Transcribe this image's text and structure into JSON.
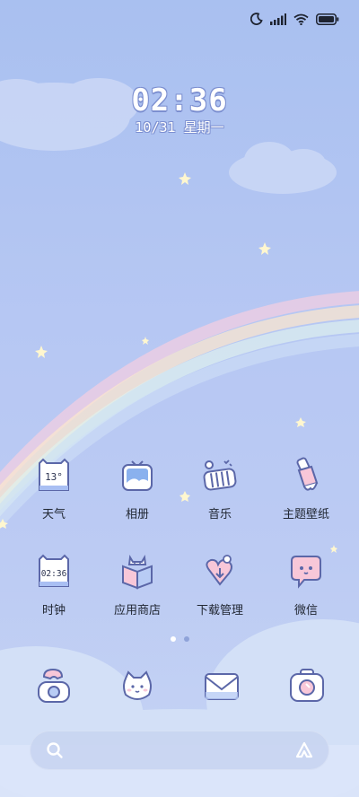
{
  "status_bar": {
    "icons": [
      "moon-icon",
      "signal-icon",
      "wifi-icon",
      "battery-icon"
    ]
  },
  "clock": {
    "time": "02:36",
    "date": "10/31 星期一"
  },
  "apps": [
    {
      "label": "天气",
      "icon": "weather-calendar-icon",
      "badge": "13°"
    },
    {
      "label": "相册",
      "icon": "photo-frame-icon"
    },
    {
      "label": "音乐",
      "icon": "piano-icon"
    },
    {
      "label": "主题壁纸",
      "icon": "paintbrush-icon"
    },
    {
      "label": "时钟",
      "icon": "clock-calendar-icon",
      "badge": "02:36"
    },
    {
      "label": "应用商店",
      "icon": "cat-box-icon"
    },
    {
      "label": "下载管理",
      "icon": "heart-download-icon"
    },
    {
      "label": "微信",
      "icon": "chat-bubble-icon"
    }
  ],
  "page_indicator": {
    "current": 1,
    "total": 2
  },
  "dock": [
    {
      "icon": "phone-icon"
    },
    {
      "icon": "cat-face-icon"
    },
    {
      "icon": "mail-icon"
    },
    {
      "icon": "camera-icon"
    }
  ],
  "search_bar": {
    "left_icon": "search-icon",
    "right_icon": "assistant-icon"
  },
  "colors": {
    "accent": "#7c8fd0",
    "label_text": "#222834",
    "icon_outline": "#5b67a8"
  }
}
